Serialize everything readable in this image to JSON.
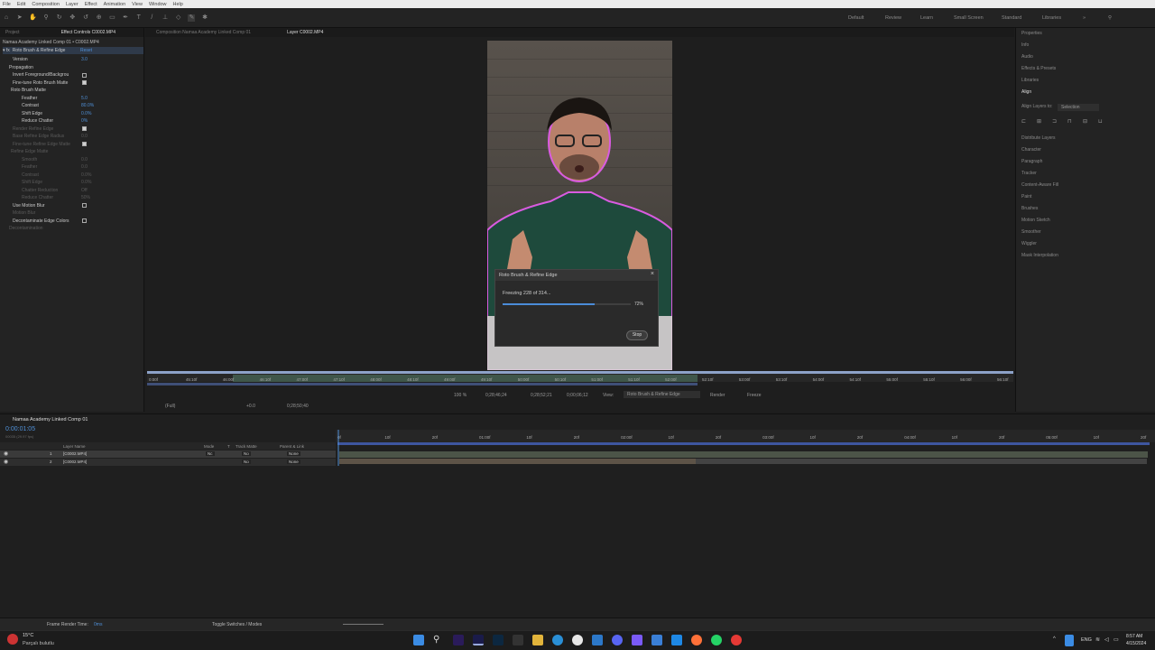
{
  "menubar": {
    "items": [
      "File",
      "Edit",
      "Composition",
      "Layer",
      "Effect",
      "Animation",
      "View",
      "Window",
      "Help"
    ]
  },
  "workspaces": [
    "Default",
    "Review",
    "Learn",
    "Small Screen",
    "Standard",
    "Libraries"
  ],
  "left_panel": {
    "tabs": [
      "Project",
      "Effect Controls C0002.MP4"
    ],
    "subtitle": "Namaa Academy Linked Comp 01 • C0002.MP4",
    "effect_name": "Roto Brush & Refine Edge",
    "reset": "Reset",
    "properties": [
      {
        "label": "Version",
        "value": "3.0",
        "dim": false
      },
      {
        "label": "Propagation",
        "value": "",
        "dim": false
      },
      {
        "label": "Invert Foreground/Backgrou",
        "value": "",
        "dim": false
      },
      {
        "label": "Fine-tune Roto Brush Matte",
        "value": "",
        "dim": false
      },
      {
        "label": "Roto Brush Matte",
        "value": "",
        "dim": false
      },
      {
        "label": "Feather",
        "value": "5.0",
        "dim": false
      },
      {
        "label": "Contrast",
        "value": "80.0%",
        "dim": false
      },
      {
        "label": "Shift Edge",
        "value": "0.0%",
        "dim": false
      },
      {
        "label": "Reduce Chatter",
        "value": "0%",
        "dim": false
      },
      {
        "label": "Render Refine Edge",
        "value": "",
        "dim": true
      },
      {
        "label": "Base Refine Edge Radius",
        "value": "0.0",
        "dim": true
      },
      {
        "label": "Fine-tune Refine Edge Matte",
        "value": "",
        "dim": true
      },
      {
        "label": "Refine Edge Matte",
        "value": "",
        "dim": true
      },
      {
        "label": "Smooth",
        "value": "0.0",
        "dim": true
      },
      {
        "label": "Feather",
        "value": "0.0",
        "dim": true
      },
      {
        "label": "Contrast",
        "value": "0.0%",
        "dim": true
      },
      {
        "label": "Shift Edge",
        "value": "0.0%",
        "dim": true
      },
      {
        "label": "Chatter Reduction",
        "value": "Off",
        "dim": true
      },
      {
        "label": "Reduce Chatter",
        "value": "50%",
        "dim": true
      },
      {
        "label": "Use Motion Blur",
        "value": "",
        "dim": false
      },
      {
        "label": "Motion Blur",
        "value": "",
        "dim": true
      },
      {
        "label": "Decontaminate Edge Colors",
        "value": "",
        "dim": false
      },
      {
        "label": "Decontamination",
        "value": "",
        "dim": true
      }
    ]
  },
  "viewer": {
    "tabs": [
      "Composition Namaa Academy Linked Comp 01",
      "Layer C0002.MP4"
    ],
    "ruler_labels": [
      "0:00f",
      "45:10f",
      "46:00f",
      "46:10f",
      "47:00f",
      "47:10f",
      "48:00f",
      "48:10f",
      "49:00f",
      "49:10f",
      "50:00f",
      "50:10f",
      "51:00f",
      "51:10f",
      "52:00f",
      "52:10f",
      "53:00f",
      "53:10f",
      "54:00f",
      "54:10f",
      "55:00f",
      "55:10f",
      "56:00f",
      "56:10f"
    ],
    "bar": {
      "zoom": "100 %",
      "tc1": "0;28;46;24",
      "tc2": "0;28;52;21",
      "tc3": "0;00;06;12",
      "view_label": "View:",
      "view_value": "Roto Brush & Refine Edge",
      "render": "Render",
      "freeze": "Freeze"
    },
    "sub_bar": {
      "zoom": "(Full)",
      "tc": "0;28;50;40",
      "offset": "+0.0"
    }
  },
  "dialog": {
    "title": "Roto Brush & Refine Edge",
    "message": "Freezing 228 of 314...",
    "percent_label": "72%",
    "progress": 0.72,
    "stop": "Stop"
  },
  "right_panel": {
    "items": [
      "Properties",
      "Info",
      "Audio",
      "Effects & Presets",
      "Libraries",
      "Align",
      "Align Layers to:",
      "Distribute Layers",
      "Character",
      "Paragraph",
      "Tracker",
      "Content-Aware Fill",
      "Paint",
      "Brushes",
      "Motion Sketch",
      "Smoother",
      "Wiggler",
      "Mask Interpolation"
    ],
    "align_to": "Selection"
  },
  "timeline": {
    "tab": "Namaa Academy Linked Comp 01",
    "timecode": "0:00:01:05",
    "fps": "00035 (29.97 fps)",
    "headers": [
      "Layer Name",
      "Mode",
      "T",
      "Track Matte",
      "Parent & Link"
    ],
    "layers": [
      {
        "num": "1",
        "name": "[C0002.MP4]",
        "mode": "Nc",
        "matte": "No",
        "parent": "None"
      },
      {
        "num": "2",
        "name": "[C0002.MP4]",
        "mode": "",
        "matte": "No",
        "parent": "None"
      }
    ],
    "ruler": [
      "0f",
      "10f",
      "20f",
      "01:00f",
      "10f",
      "20f",
      "02:00f",
      "10f",
      "20f",
      "03:00f",
      "10f",
      "20f",
      "04:00f",
      "10f",
      "20f",
      "05:00f",
      "10f",
      "20f"
    ]
  },
  "statusbar": {
    "render_time_label": "Frame Render Time:",
    "render_time": "0ms",
    "toggle": "Toggle Switches / Modes"
  },
  "taskbar": {
    "weather_temp": "15°C",
    "weather_desc": "Parçalı bulutlu",
    "lang": "ENG",
    "time": "8:57 AM",
    "date": "4/15/2024"
  }
}
